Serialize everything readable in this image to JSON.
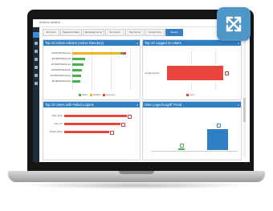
{
  "app": {
    "title": "netwrix auditor"
  },
  "expand_button": {
    "icon": "expand-arrows-icon",
    "color": "#4f96c9"
  },
  "tabs": [
    {
      "label": "AD Users"
    },
    {
      "label": "Password Status"
    },
    {
      "label": "Exchange Server"
    },
    {
      "label": "File Server"
    },
    {
      "label": "SQL Server"
    },
    {
      "label": "Group Policy"
    },
    {
      "label": "Events"
    }
  ],
  "active_tab_index": 6,
  "panels": {
    "active_admins": {
      "title": "Top 10 Active Admins (Active Directory)",
      "rows": [
        {
          "label": "ENTERPRISE\\admin"
        },
        {
          "label": "ENTERPRISE\\jsmith"
        },
        {
          "label": "ENTERPRISE\\bjones"
        },
        {
          "label": "ENTERPRISE\\kwhite"
        },
        {
          "label": "ENTERPRISE\\mgreen"
        },
        {
          "label": "ENTERPRISE\\tblack"
        }
      ],
      "legend": [
        "Added",
        "Modified",
        "Removed"
      ],
      "colors": {
        "added": "#4caf50",
        "modified": "#f0b323",
        "removed": "#e8453c"
      }
    },
    "logged_on_users": {
      "title": "Top 10 Logged on Users",
      "rows": [
        {
          "label": "user@enterprise"
        }
      ],
      "legend": [
        "Users"
      ],
      "color": "#e8453c"
    },
    "failed_logons": {
      "title": "Top 10 Users with Failed Logons",
      "rows": [
        {
          "label": "Mark_Boyle"
        },
        {
          "label": "Luke_Tim"
        },
        {
          "label": "Richard_Boyle"
        }
      ],
      "color": "#e8453c"
    },
    "logon_trend": {
      "title": "User Logon/Logoff Trend",
      "series_colors": {
        "logon": "#2f7fc4",
        "logoff": "#4caf50"
      }
    }
  }
}
